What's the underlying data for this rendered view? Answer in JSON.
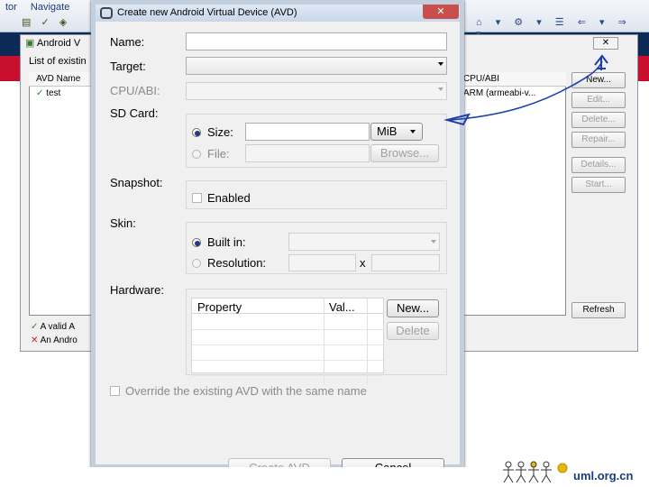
{
  "eclipse": {
    "menu": [
      "tor",
      "Navigate"
    ],
    "tab_title": "Android V",
    "list_label": "List of existin",
    "columns": [
      "AVD Name",
      "CPU/ABI"
    ],
    "row": {
      "name": "test",
      "abi": "ARM (armeabi-v..."
    },
    "buttons": [
      "New...",
      "Edit...",
      "Delete...",
      "Repair...",
      "Details...",
      "Start...",
      "Refresh"
    ],
    "legend_valid": "A valid A",
    "legend_invalid": "An Andro"
  },
  "dialog": {
    "title": "Create new Android Virtual Device (AVD)",
    "name_label": "Name:",
    "name_value": "",
    "target_label": "Target:",
    "target_value": "",
    "cpu_label": "CPU/ABI:",
    "cpu_value": "",
    "sdcard_label": "SD Card:",
    "size_label": "Size:",
    "size_value": "",
    "size_unit": "MiB",
    "file_label": "File:",
    "browse_label": "Browse...",
    "snapshot_label": "Snapshot:",
    "enabled_label": "Enabled",
    "skin_label": "Skin:",
    "builtin_label": "Built in:",
    "resolution_label": "Resolution:",
    "res_x": "x",
    "hardware_label": "Hardware:",
    "hw_columns": [
      "Property",
      "Val..."
    ],
    "hw_new": "New...",
    "hw_delete": "Delete",
    "override_label": "Override the existing AVD with the same name",
    "create_button": "Create AVD",
    "cancel_button": "Cancel"
  },
  "logo": {
    "text": "uml.org.cn"
  },
  "colors": {
    "band_blue": "#0d2a57",
    "band_red": "#c8102e",
    "pen_blue": "#1d3fae"
  }
}
